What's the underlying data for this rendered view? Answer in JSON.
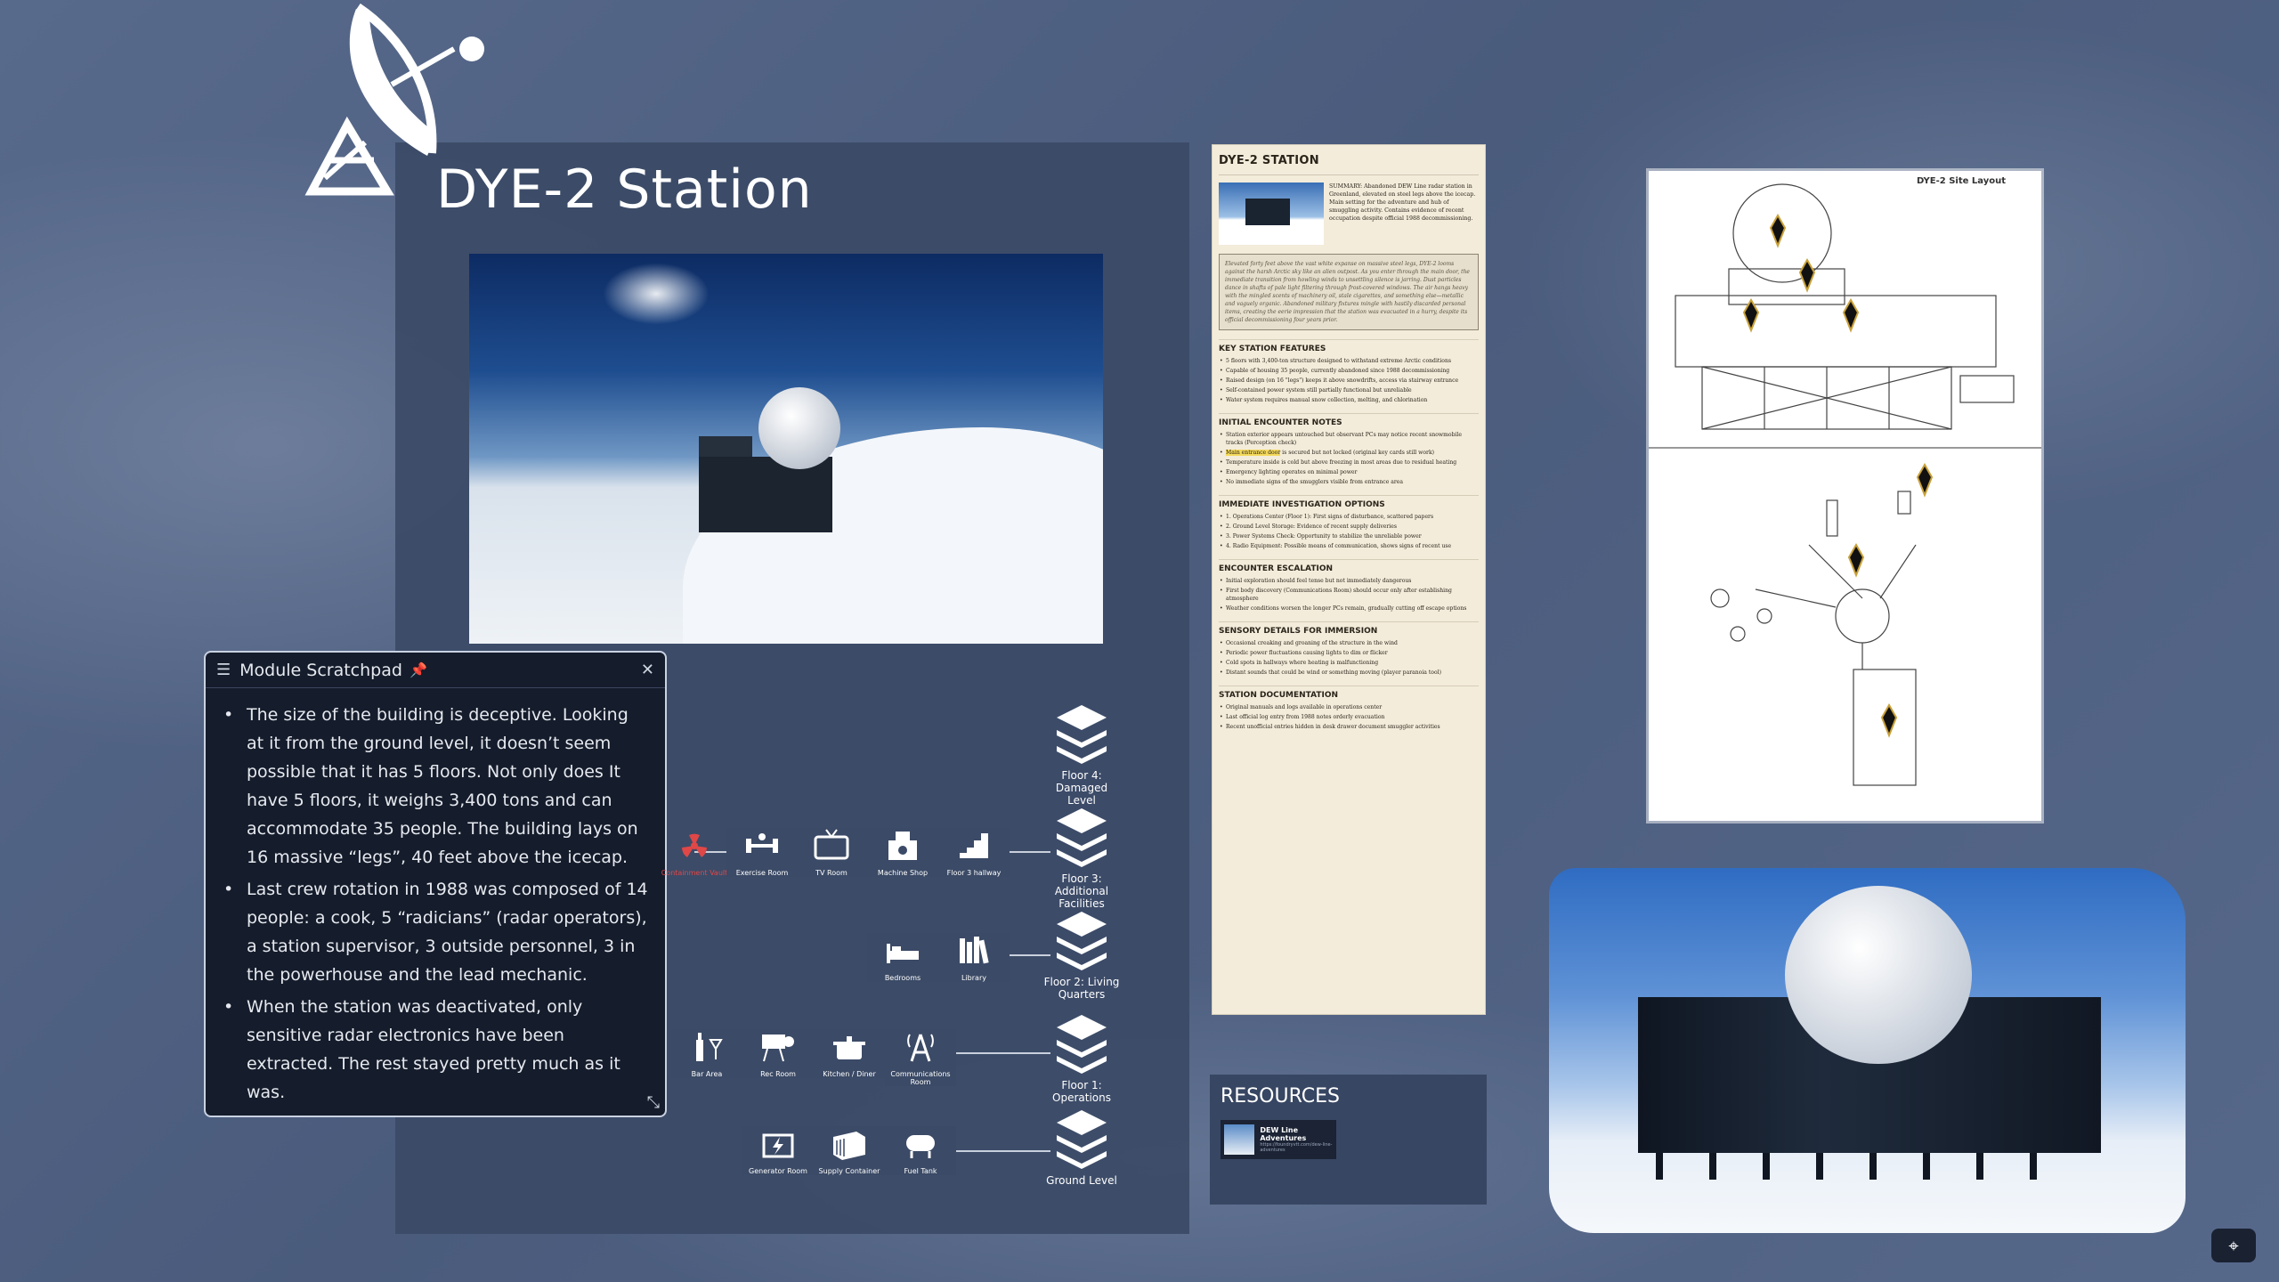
{
  "scene": {
    "title": "DYE-2 Station"
  },
  "scratchpad": {
    "title": "Module Scratchpad",
    "items": [
      "The size of the building is deceptive. Looking at it from the ground level, it doesn’t seem possible that it has 5 floors. Not only does It have 5 floors, it weighs 3,400 tons and can accommodate 35 people. The building lays on 16 massive “legs”, 40 feet above the icecap.",
      "Last crew rotation in 1988 was composed of 14 people: a cook, 5 “radicians” (radar operators), a station supervisor, 3 outside personnel, 3 in the powerhouse and the lead mechanic.",
      "When the station was deactivated, only sensitive radar electronics have been extracted. The rest stayed pretty much as it was."
    ]
  },
  "diagram": {
    "floors": [
      "Floor 4: Damaged Level",
      "Floor 3: Additional Facilities",
      "Floor 2: Living Quarters",
      "Floor 1: Operations",
      "Ground Level"
    ],
    "floor3_rooms": [
      "Containment Vault",
      "Exercise Room",
      "TV Room",
      "Machine Shop",
      "Floor 3 hallway"
    ],
    "floor2_rooms": [
      "Bedrooms",
      "Library"
    ],
    "floor1_rooms": [
      "Bar Area",
      "Rec Room",
      "Kitchen / Diner",
      "Communications Room"
    ],
    "ground_rooms": [
      "Generator Room",
      "Supply Container",
      "Fuel Tank"
    ]
  },
  "document": {
    "title": "DYE-2 STATION",
    "summary": "SUMMARY: Abandoned DEW Line radar station in Greenland, elevated on steel legs above the icecap. Main setting for the adventure and hub of smuggling activity. Contains evidence of recent occupation despite official 1988 decommissioning.",
    "quote": "Elevated forty feet above the vast white expanse on massive steel legs, DYE-2 looms against the harsh Arctic sky like an alien outpost. As you enter through the main door, the immediate transition from howling winds to unsettling silence is jarring. Dust particles dance in shafts of pale light filtering through frost-covered windows. The air hangs heavy with the mingled scents of machinery oil, stale cigarettes, and something else—metallic and vaguely organic. Abandoned military fixtures mingle with hastily discarded personal items, creating the eerie impression that the station was evacuated in a hurry, despite its official decommissioning four years prior.",
    "sections": [
      {
        "heading": "KEY STATION FEATURES",
        "items": [
          "5 floors with 3,400-ton structure designed to withstand extreme Arctic conditions",
          "Capable of housing 35 people, currently abandoned since 1988 decommissioning",
          "Raised design (on 16 \"legs\") keeps it above snowdrifts, access via stairway entrance",
          "Self-contained power system still partially functional but unreliable",
          "Water system requires manual snow collection, melting, and chlorination"
        ]
      },
      {
        "heading": "INITIAL ENCOUNTER NOTES",
        "items": [
          "Station exterior appears untouched but observant PCs may notice recent snowmobile tracks (Perception check)",
          "Main entrance door is secured but not locked (original key cards still work)",
          "Temperature inside is cold but above freezing in most areas due to residual heating",
          "Emergency lighting operates on minimal power",
          "No immediate signs of the smugglers visible from entrance area"
        ]
      },
      {
        "heading": "IMMEDIATE INVESTIGATION OPTIONS",
        "items": [
          "1. Operations Center (Floor 1): First signs of disturbance, scattered papers",
          "2. Ground Level Storage: Evidence of recent supply deliveries",
          "3. Power Systems Check: Opportunity to stabilize the unreliable power",
          "4. Radio Equipment: Possible means of communication, shows signs of recent use"
        ]
      },
      {
        "heading": "ENCOUNTER ESCALATION",
        "items": [
          "Initial exploration should feel tense but not immediately dangerous",
          "First body discovery (Communications Room) should occur only after establishing atmosphere",
          "Weather conditions worsen the longer PCs remain, gradually cutting off escape options"
        ]
      },
      {
        "heading": "SENSORY DETAILS FOR IMMERSION",
        "items": [
          "Occasional creaking and groaning of the structure in the wind",
          "Periodic power fluctuations causing lights to dim or flicker",
          "Cold spots in hallways where heating is malfunctioning",
          "Distant sounds that could be wind or something moving (player paranoia tool)"
        ]
      },
      {
        "heading": "STATION DOCUMENTATION",
        "items": [
          "Original manuals and logs available in operations center",
          "Last official log entry from 1988 notes orderly evacuation",
          "Recent unofficial entries hidden in desk drawer document smuggler activities"
        ]
      }
    ]
  },
  "resources": {
    "heading": "RESOURCES",
    "card_title": "DEW Line Adventures",
    "card_sub": "https://foundryvtt.com/dew-line-adventures"
  },
  "sitemap": {
    "caption": "DYE-2 Site Layout"
  },
  "colors": {
    "background": "#4e5f80",
    "panel": "#3b4a66",
    "scratchpad": "#151c2b",
    "alert": "#e04747",
    "paper": "#f3ecdb"
  }
}
